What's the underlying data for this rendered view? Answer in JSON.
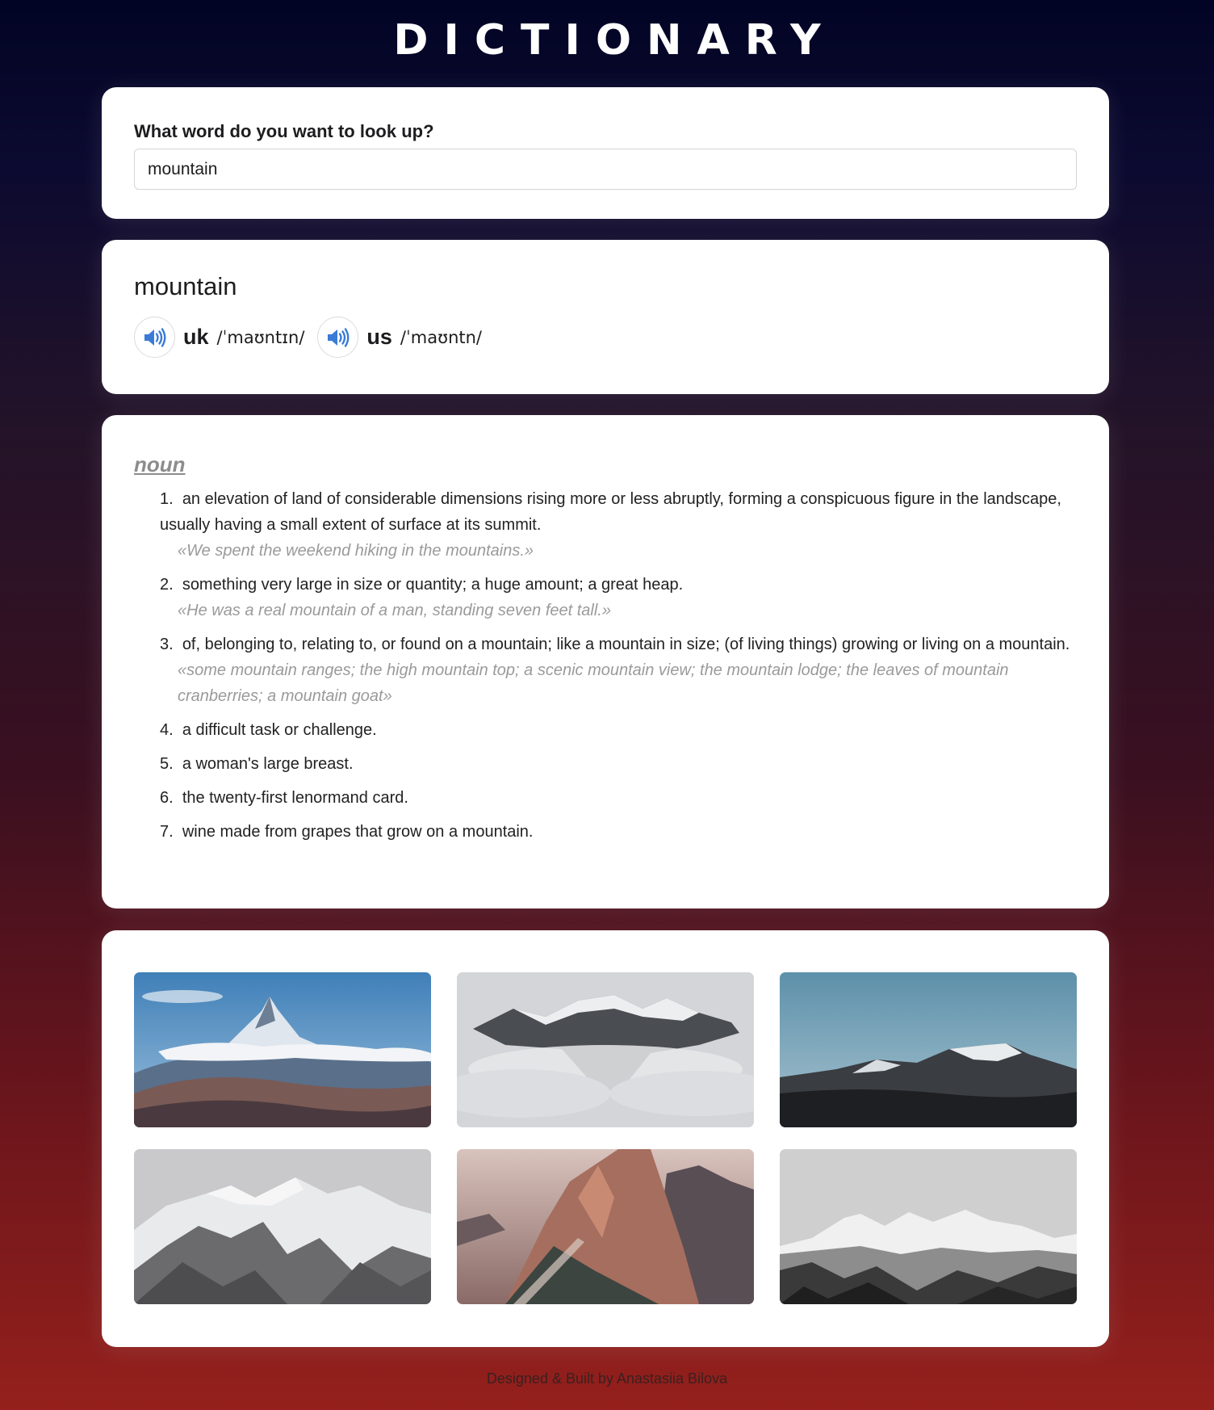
{
  "header": {
    "title": "DICTIONARY"
  },
  "search": {
    "label": "What word do you want to look up?",
    "value": "mountain"
  },
  "word": {
    "headword": "mountain",
    "phonetics": [
      {
        "region": "uk",
        "ipa": "/ˈmaʊntɪn/",
        "icon": "speaker-icon"
      },
      {
        "region": "us",
        "ipa": "/ˈmaʊntn/",
        "icon": "speaker-icon"
      }
    ]
  },
  "meaning": {
    "part_of_speech": "noun",
    "definitions": [
      {
        "num": "1.",
        "text": "an elevation of land of considerable dimensions rising more or less abruptly, forming a conspicuous figure in the landscape, usually having a small extent of surface at its summit.",
        "example": "«We spent the weekend hiking in the mountains.»"
      },
      {
        "num": "2.",
        "text": "something very large in size or quantity; a huge amount; a great heap.",
        "example": "«He was a real mountain of a man, standing seven feet tall.»"
      },
      {
        "num": "3.",
        "text": "of, belonging to, relating to, or found on a mountain; like a mountain in size; (of living things) growing or living on a mountain.",
        "example": "«some mountain ranges; the high mountain top; a scenic mountain view; the mountain lodge; the leaves of mountain cranberries; a mountain goat»"
      },
      {
        "num": "4.",
        "text": "a difficult task or challenge.",
        "example": ""
      },
      {
        "num": "5.",
        "text": "a woman's large breast.",
        "example": ""
      },
      {
        "num": "6.",
        "text": "the twenty-first lenormand card.",
        "example": ""
      },
      {
        "num": "7.",
        "text": "wine made from grapes that grow on a mountain.",
        "example": ""
      }
    ]
  },
  "photos": [
    {
      "name": "photo-mountain-1"
    },
    {
      "name": "photo-mountain-2"
    },
    {
      "name": "photo-mountain-3"
    },
    {
      "name": "photo-mountain-4"
    },
    {
      "name": "photo-mountain-5"
    },
    {
      "name": "photo-mountain-6"
    }
  ],
  "footer": {
    "text": "Designed & Built by Anastasiia Bilova"
  },
  "colors": {
    "accent": "#3a7bd5",
    "muted": "#9a9a9a"
  }
}
